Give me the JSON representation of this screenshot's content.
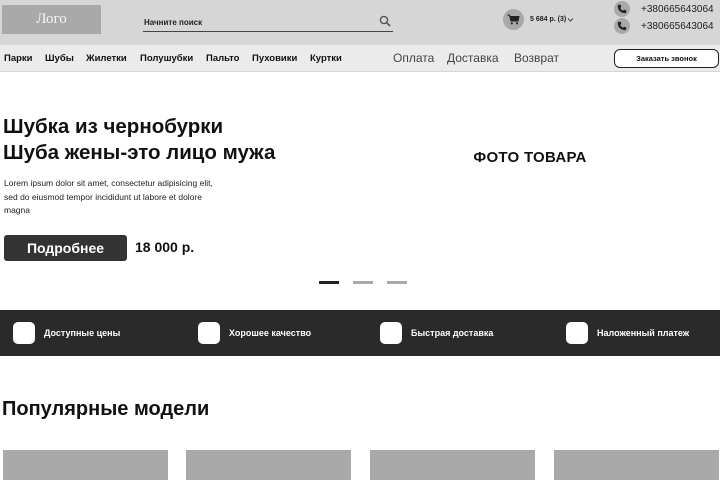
{
  "header": {
    "logo_text": "Лого",
    "search": {
      "placeholder": "Начните поиск",
      "icon": "search-icon"
    },
    "cart": {
      "text": "5 684 р. (3)",
      "icon": "cart-icon"
    },
    "phones": [
      "+380665643064",
      "+380665643064"
    ]
  },
  "nav": {
    "categories": [
      "Парки",
      "Шубы",
      "Жилетки",
      "Полушубки",
      "Пальто",
      "Пуховики",
      "Куртки"
    ],
    "info_links": [
      "Оплата",
      "Доставка",
      "Возврат"
    ],
    "callback_button": "Заказать звонок"
  },
  "hero": {
    "title_line1": "Шубка из чернобурки",
    "title_line2": "Шуба жены-это лицо мужа",
    "description": "Lorem ipsum dolor sit amet, consectetur adipisicing elit, sed do eiusmod tempor incididunt ut labore et dolore magna",
    "details_button": "Подробнее",
    "price": "18 000 р.",
    "photo_placeholder": "ФОТО ТОВАРА",
    "slides_count": 3,
    "active_slide": 1
  },
  "features": [
    "Доступные цены",
    "Хорошее качество",
    "Быстрая доставка",
    "Наложенный платеж"
  ],
  "popular": {
    "title": "Популярные модели",
    "cards_visible": 4
  },
  "colors": {
    "header_bg": "#d6d6d6",
    "placeholder_gray": "#a9a9a9",
    "dark": "#2a2a2a",
    "button_dark": "#333333"
  }
}
